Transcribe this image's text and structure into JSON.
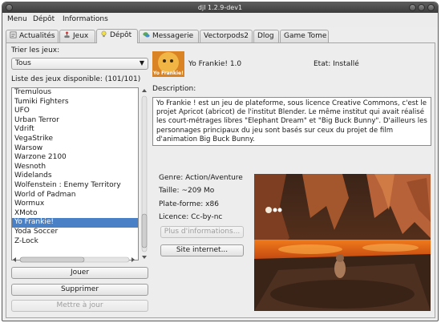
{
  "window": {
    "title": "djl 1.2.9-dev1"
  },
  "menu": [
    "Menu",
    "Dépôt",
    "Informations"
  ],
  "tabs": [
    {
      "label": "Actualités",
      "icon": "newspaper-icon",
      "active": false
    },
    {
      "label": "Jeux",
      "icon": "joystick-icon",
      "active": false
    },
    {
      "label": "Dépôt",
      "icon": "bulb-icon",
      "active": true
    },
    {
      "label": "Messagerie",
      "icon": "chat-icon",
      "active": false
    },
    {
      "label": "Vectorpods2",
      "icon": "",
      "active": false
    },
    {
      "label": "Dlog",
      "icon": "",
      "active": false
    },
    {
      "label": "Game Tome",
      "icon": "",
      "active": false
    }
  ],
  "filter": {
    "label": "Trier les jeux:",
    "value": "Tous"
  },
  "list": {
    "label": "Liste des jeux disponible: (101/101)",
    "items": [
      "Tremulous",
      "Tumiki Fighters",
      "UFO",
      "Urban Terror",
      "Vdrift",
      "VegaStrike",
      "Warsow",
      "Warzone 2100",
      "Wesnoth",
      "Widelands",
      "Wolfenstein : Enemy Territory",
      "World of Padman",
      "Wormux",
      "XMoto",
      "Yo Frankie!",
      "Yoda Soccer",
      "Z-Lock"
    ],
    "selected": "Yo Frankie!"
  },
  "actions": {
    "play": "Jouer",
    "remove": "Supprimer",
    "update": "Mettre à jour"
  },
  "game": {
    "logo_text": "Yo Frankie!",
    "name": "Yo Frankie! 1.0",
    "state": "Etat: Installé",
    "description_label": "Description:",
    "description": "Yo Frankie ! est un jeu de plateforme, sous licence Creative Commons, c'est le projet Apricot (abricot) de l'institut Blender. Le même institut qui avait réalisé les court-métrages libres \"Elephant Dream\" et \"Big Buck Bunny\". D'ailleurs les personnages principaux du jeu sont basés sur ceux du projet de film d'animation Big Buck Bunny.",
    "genre": "Genre: Action/Aventure",
    "size": "Taille: ~209 Mo",
    "platform": "Plate-forme: x86",
    "license": "Licence: Cc-by-nc",
    "more_info": "Plus d'informations...",
    "website": "Site internet..."
  },
  "colors": {
    "selection": "#4a80c6",
    "titlebar": "#4a4a4a"
  }
}
